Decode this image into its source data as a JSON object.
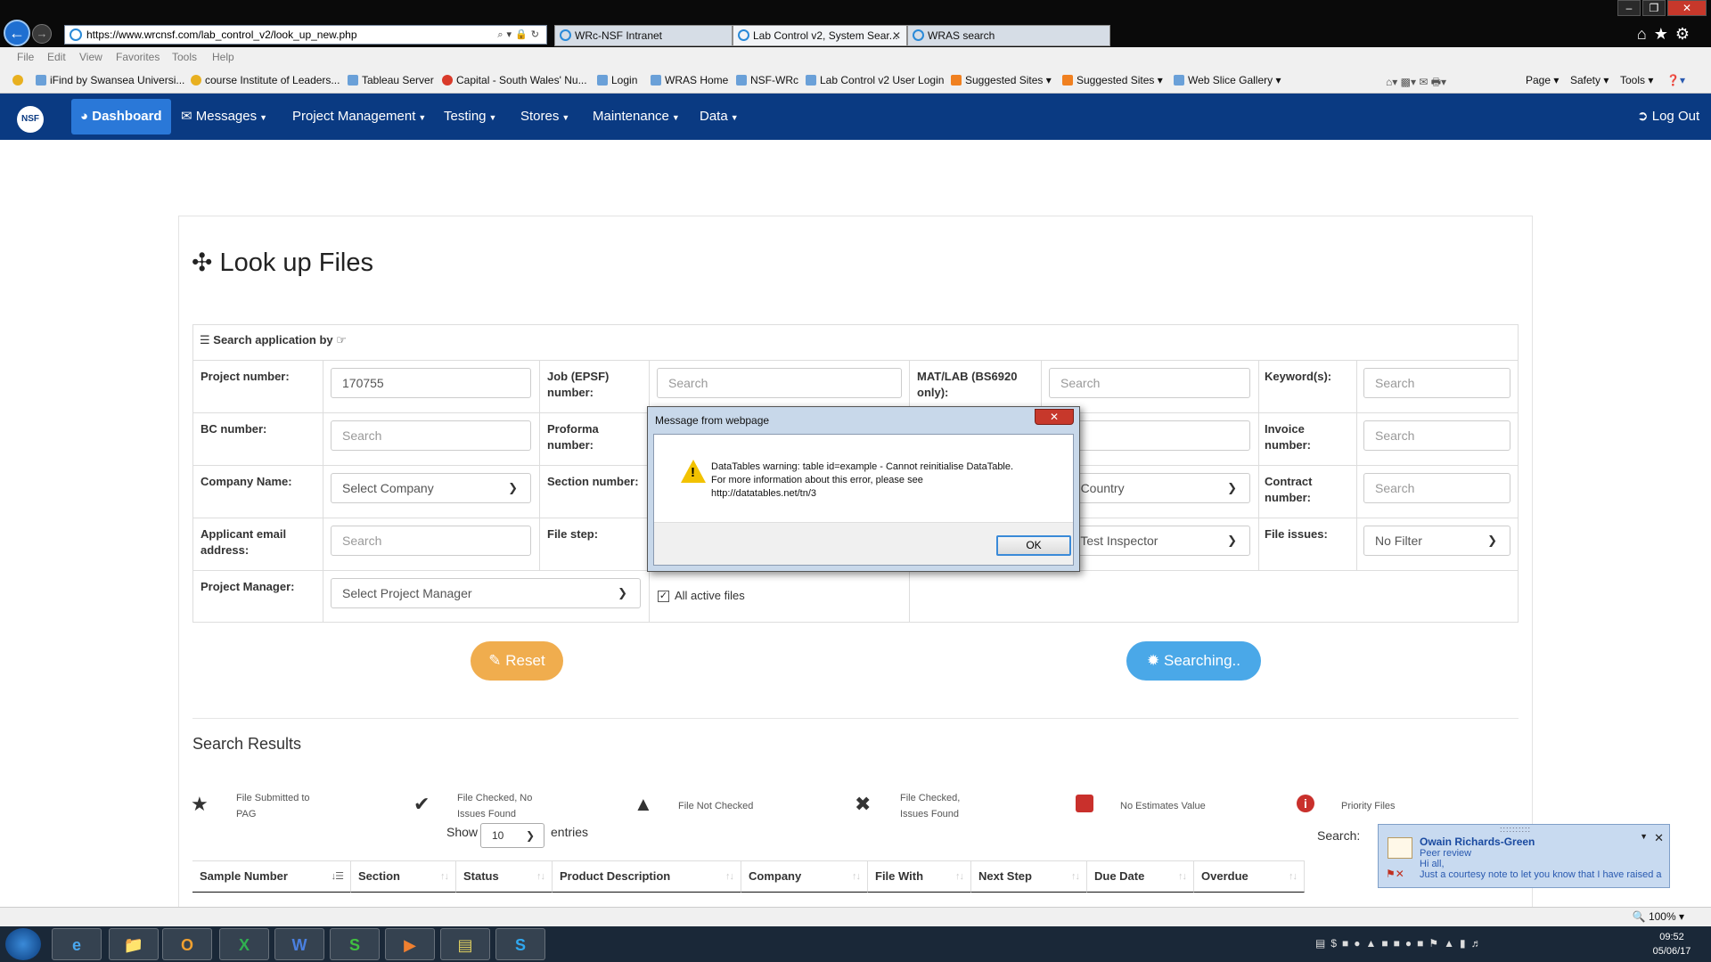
{
  "browser": {
    "url": "https://www.wrcnsf.com/lab_control_v2/look_up_new.php",
    "tabs": [
      {
        "title": "WRc-NSF Intranet"
      },
      {
        "title": "Lab Control v2, System Sear..."
      },
      {
        "title": "WRAS search"
      }
    ],
    "menu": [
      "File",
      "Edit",
      "View",
      "Favorites",
      "Tools",
      "Help"
    ],
    "favorites": [
      "iFind by Swansea Universi...",
      "course Institute of Leaders...",
      "Tableau Server",
      "Capital - South Wales' Nu...",
      "Login",
      "WRAS Home",
      "NSF-WRc",
      "Lab Control v2 User Login",
      "Suggested Sites ▾",
      "Suggested Sites ▾",
      "Web Slice Gallery ▾"
    ],
    "command_bar": [
      "Page ▾",
      "Safety ▾",
      "Tools ▾"
    ],
    "zoom": "100%"
  },
  "nav": {
    "logo": "NSF",
    "items": [
      {
        "label": "Dashboard",
        "icon": "dashboard-icon"
      },
      {
        "label": "Messages",
        "icon": "envelope-icon"
      },
      {
        "label": "Project Management"
      },
      {
        "label": "Testing"
      },
      {
        "label": "Stores"
      },
      {
        "label": "Maintenance"
      },
      {
        "label": "Data"
      }
    ],
    "logout": "Log Out"
  },
  "page": {
    "title": "Look up Files",
    "search_header": "Search application by",
    "fields": {
      "project_number": {
        "label": "Project number:",
        "value": "170755"
      },
      "job_epsf": {
        "label": "Job (EPSF) number:",
        "placeholder": "Search"
      },
      "mat_lab": {
        "label": "MAT/LAB (BS6920 only):",
        "placeholder": "Search"
      },
      "keywords": {
        "label": "Keyword(s):",
        "placeholder": "Search"
      },
      "bc_number": {
        "label": "BC number:",
        "placeholder": "Search"
      },
      "proforma": {
        "label": "Proforma number:"
      },
      "wras_partial": {
        "placeholder": "ch"
      },
      "invoice": {
        "label": "Invoice number:",
        "placeholder": "Search"
      },
      "company": {
        "label": "Company Name:",
        "value": "Select Company"
      },
      "section": {
        "label": "Section number:"
      },
      "country": {
        "value": "ect Country"
      },
      "contract": {
        "label": "Contract number:",
        "placeholder": "Search"
      },
      "applicant_email": {
        "label": "Applicant email address:",
        "placeholder": "Search"
      },
      "file_step": {
        "label": "File step:"
      },
      "inspector": {
        "value": "ect Test Inspector"
      },
      "file_issues": {
        "label": "File issues:",
        "value": "No Filter"
      },
      "project_manager": {
        "label": "Project Manager:",
        "value": "Select Project Manager"
      },
      "all_active": {
        "label": "All active files",
        "checked": true
      }
    },
    "reset_label": "Reset",
    "search_label": "Searching..",
    "results_title": "Search Results",
    "legend": [
      {
        "icon": "star-icon",
        "text": "File Submitted to PAG"
      },
      {
        "icon": "check-icon",
        "text": "File Checked, No Issues Found"
      },
      {
        "icon": "warning-icon",
        "text": "File Not Checked"
      },
      {
        "icon": "x-icon",
        "text": "File Checked, Issues Found"
      },
      {
        "icon": "red-square-icon",
        "text": "No Estimates Value"
      },
      {
        "icon": "info-icon",
        "text": "Priority Files"
      }
    ],
    "show_label": "Show",
    "entries_value": "10",
    "entries_label": "entries",
    "search_table_label": "Search:",
    "columns": [
      "Sample Number",
      "Section",
      "Status",
      "Product Description",
      "Company",
      "File With",
      "Next Step",
      "Due Date",
      "Overdue"
    ]
  },
  "dialog": {
    "title": "Message from webpage",
    "line1": "DataTables warning: table id=example - Cannot reinitialise DataTable.",
    "line2": "For more information about this error, please see",
    "line3": "http://datatables.net/tn/3",
    "ok": "OK"
  },
  "notification": {
    "sender": "Owain Richards-Green",
    "subject": "Peer review",
    "greeting": "Hi all,",
    "body": "Just a courtesy note to let you know that I have raised a"
  },
  "taskbar": {
    "time": "09:52",
    "date": "05/06/17"
  },
  "colors": {
    "nav_bg": "#0a3a82",
    "nav_active": "#2a78d8",
    "reset_btn": "#f0ad4e",
    "search_btn": "#4aa8e8",
    "warning": "#f2c200"
  }
}
